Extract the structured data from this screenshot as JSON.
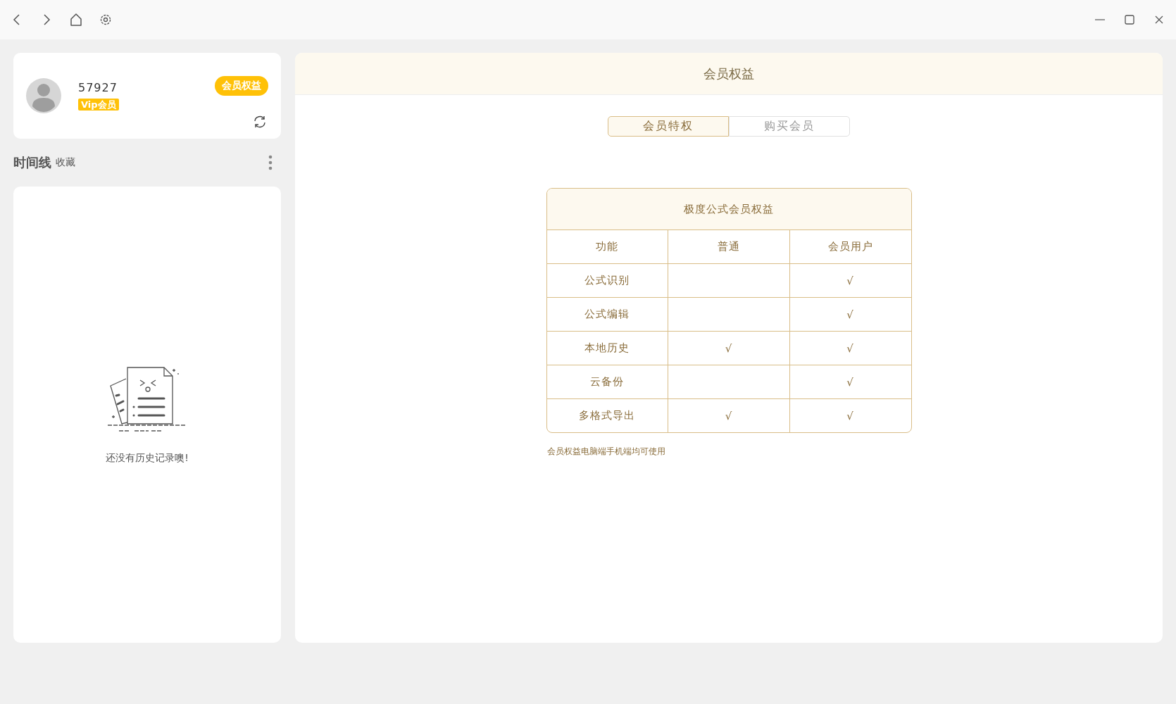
{
  "profile": {
    "user_id": "57927",
    "badge": "Vip会员",
    "benefits_button": "会员权益"
  },
  "timeline": {
    "tabs": [
      {
        "label": "时间线",
        "selected": true
      },
      {
        "label": "收藏",
        "selected": false
      }
    ]
  },
  "empty_state": {
    "message": "还没有历史记录噢!"
  },
  "panel": {
    "title": "会员权益",
    "tabs": [
      {
        "label": "会员特权",
        "selected": true
      },
      {
        "label": "购买会员",
        "selected": false
      }
    ],
    "table": {
      "title": "极度公式会员权益",
      "columns": [
        "功能",
        "普通",
        "会员用户"
      ],
      "rows": [
        {
          "cells": [
            "公式识别",
            null,
            "√"
          ]
        },
        {
          "cells": [
            "公式编辑",
            null,
            "√"
          ]
        },
        {
          "cells": [
            "本地历史",
            "√",
            "√"
          ]
        },
        {
          "cells": [
            "云备份",
            null,
            "√"
          ]
        },
        {
          "cells": [
            "多格式导出",
            "√",
            "√"
          ]
        }
      ]
    },
    "note": "会员权益电脑端手机端均可使用"
  }
}
